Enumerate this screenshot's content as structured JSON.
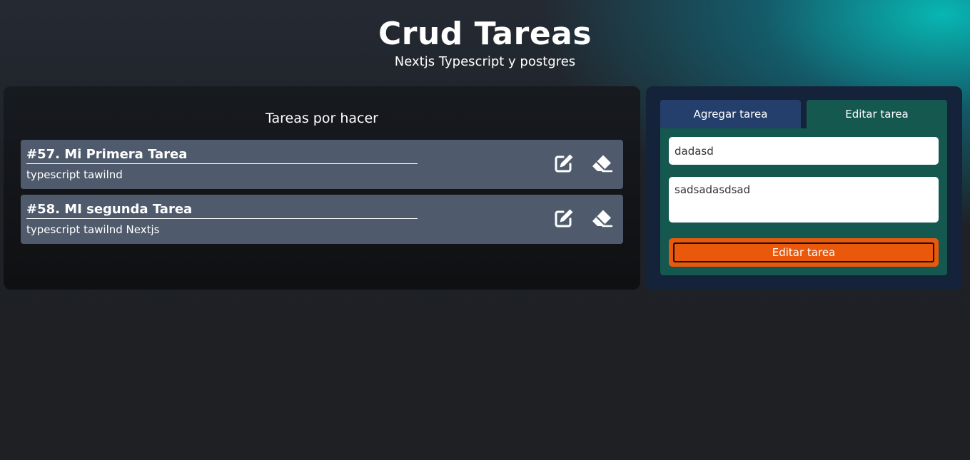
{
  "header": {
    "title": "Crud Tareas",
    "subtitle": "Nextjs Typescript y postgres"
  },
  "tasks_panel": {
    "heading": "Tareas por hacer",
    "tasks": [
      {
        "title": "#57. Mi Primera Tarea",
        "description": "typescript tawilnd",
        "edit_icon": "edit-icon",
        "delete_icon": "eraser-icon"
      },
      {
        "title": "#58. MI segunda Tarea",
        "description": "typescript tawilnd Nextjs",
        "edit_icon": "edit-icon",
        "delete_icon": "eraser-icon"
      }
    ]
  },
  "form_panel": {
    "tabs": [
      {
        "label": "Agregar tarea",
        "active": false
      },
      {
        "label": "Editar tarea",
        "active": true
      }
    ],
    "title_value": "dadasd",
    "description_value": "sadsadasdsad",
    "submit_label": "Editar tarea"
  },
  "colors": {
    "task_card": "#4f5b6c",
    "tab_inactive": "#243f6b",
    "tab_active": "#14584f",
    "submit_button": "#ea580c"
  }
}
